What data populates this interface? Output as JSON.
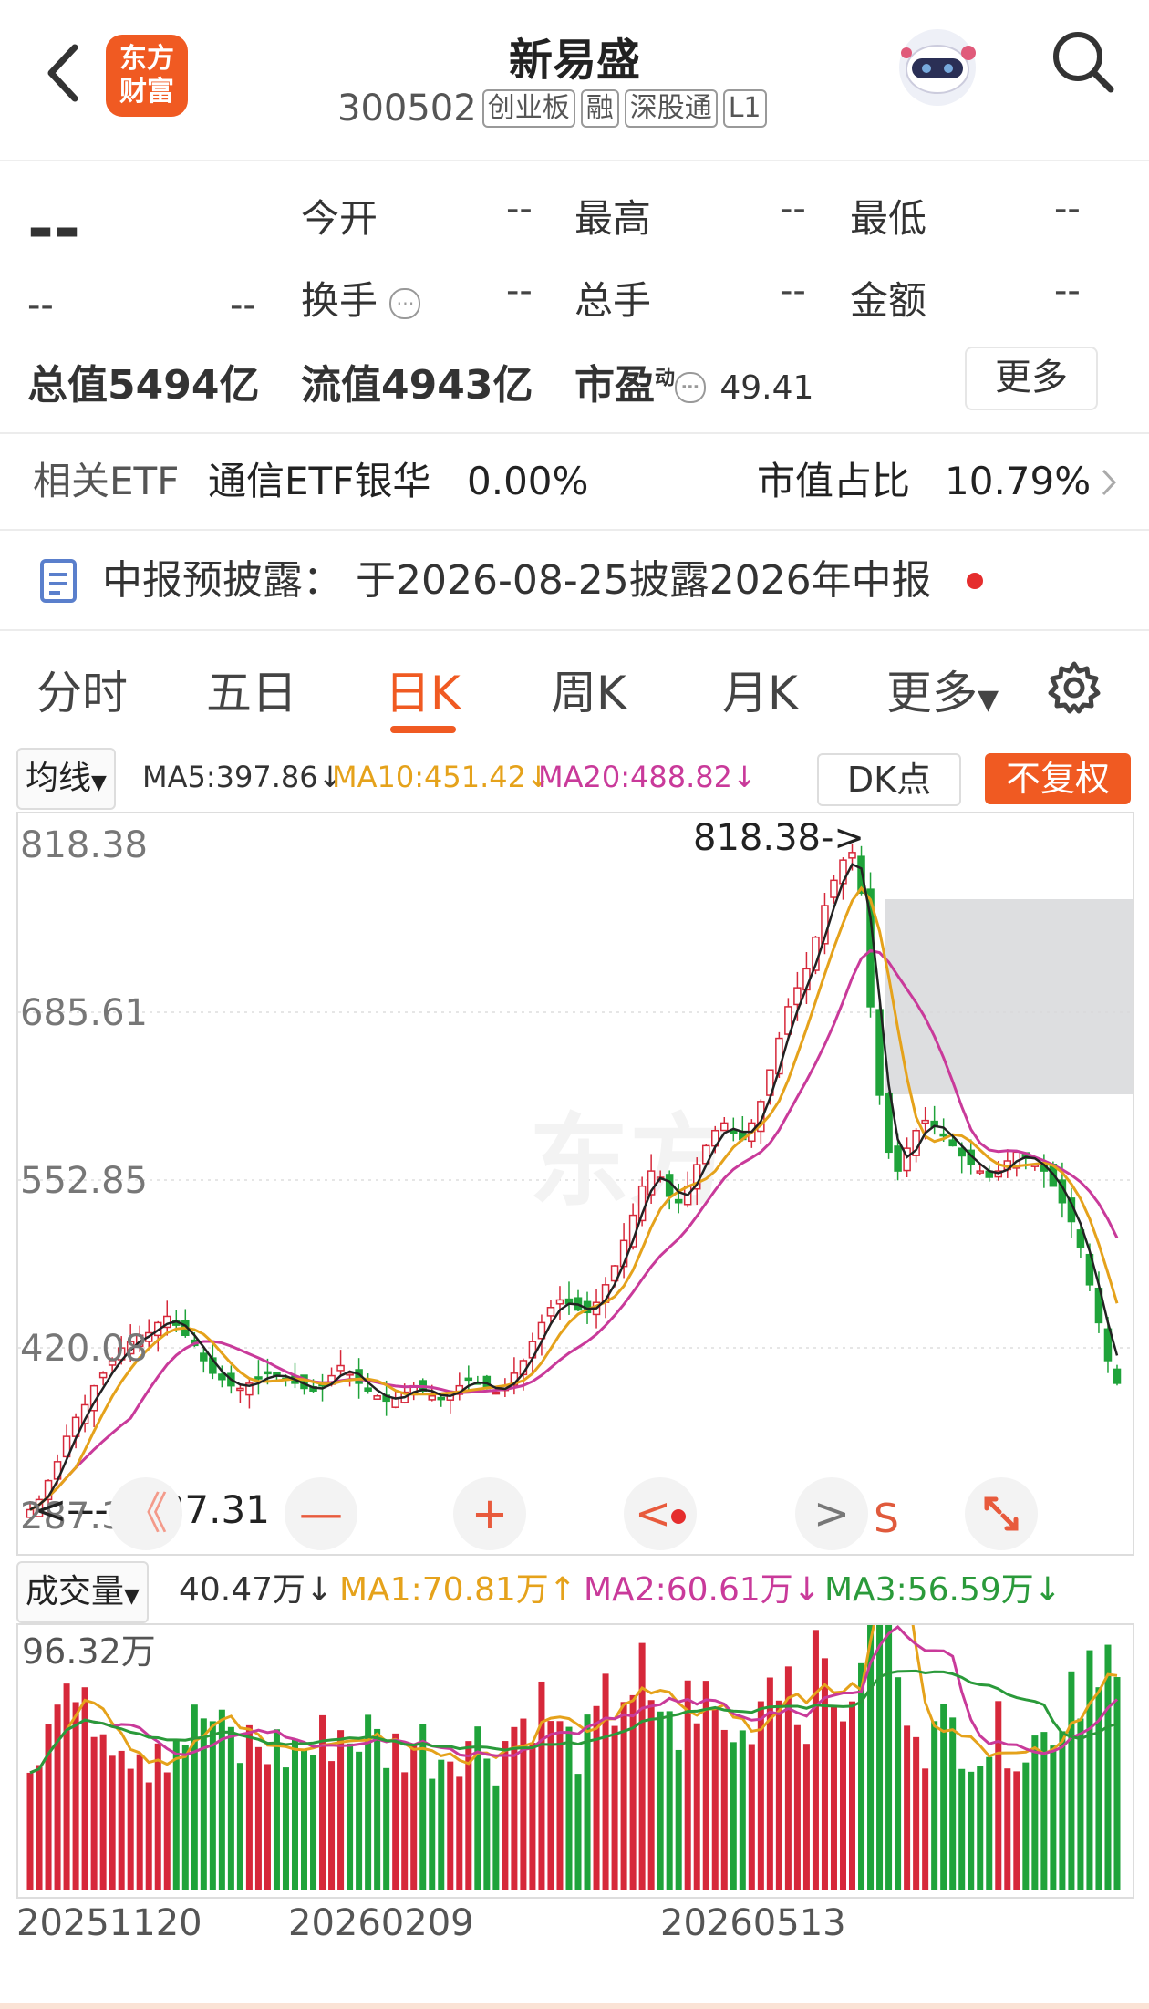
{
  "header": {
    "title": "新易盛",
    "code": "300502",
    "tags": [
      "创业板",
      "融",
      "深股通",
      "L1"
    ],
    "logo_line1": "东方",
    "logo_line2": "财富"
  },
  "quote": {
    "price": "--",
    "change": "--",
    "change_pct": "--",
    "open_label": "今开",
    "open": "--",
    "high_label": "最高",
    "high": "--",
    "low_label": "最低",
    "low": "--",
    "turnover_label": "换手",
    "turnover": "--",
    "volume_label": "总手",
    "volume": "--",
    "amount_label": "金额",
    "amount": "--",
    "total_cap": "总值5494亿",
    "float_cap": "流值4943亿",
    "pe_label": "市盈",
    "pe_sup": "动",
    "pe": "49.41",
    "more": "更多"
  },
  "etf": {
    "label": "相关ETF",
    "name": "通信ETF银华",
    "pct": "0.00%",
    "ratio_label": "市值占比",
    "ratio": "10.79%"
  },
  "disclosure": {
    "text": "中报预披露：  于2026-08-25披露2026年中报"
  },
  "tabs": [
    "分时",
    "五日",
    "日K",
    "周K",
    "月K",
    "更多"
  ],
  "active_tab": 2,
  "ma_bar": {
    "selector": "均线",
    "ma5": "MA5:397.86",
    "ma10": "MA10:451.42",
    "ma20": "MA20:488.82",
    "dk": "DK点",
    "fuquan": "不复权"
  },
  "vol_bar": {
    "selector": "成交量",
    "vol": "40.47万",
    "ma1": "MA1:70.81万",
    "ma2": "MA2:60.61万",
    "ma3": "MA3:56.59万"
  },
  "chart_data": {
    "type": "candlestick",
    "y_ticks": [
      "818.38",
      "685.61",
      "552.85",
      "420.08",
      "287.31"
    ],
    "ylim": [
      287.31,
      818.38
    ],
    "high_annotation": "818.38->",
    "low_annotation": "<-----287.31",
    "vol_max_label": "96.32万",
    "date_ticks": [
      "20251120",
      "20260209",
      "20260513"
    ],
    "close_series": [
      292,
      300,
      315,
      330,
      350,
      365,
      375,
      390,
      400,
      410,
      420,
      425,
      430,
      432,
      440,
      445,
      438,
      430,
      422,
      410,
      400,
      395,
      390,
      388,
      392,
      396,
      400,
      398,
      395,
      392,
      388,
      386,
      390,
      398,
      406,
      400,
      392,
      386,
      382,
      378,
      380,
      385,
      390,
      386,
      382,
      380,
      384,
      390,
      396,
      392,
      388,
      385,
      390,
      400,
      410,
      425,
      440,
      452,
      458,
      455,
      450,
      448,
      456,
      470,
      485,
      505,
      525,
      548,
      560,
      555,
      540,
      535,
      548,
      565,
      580,
      592,
      598,
      590,
      585,
      598,
      615,
      640,
      665,
      690,
      705,
      720,
      745,
      770,
      790,
      806,
      812,
      780,
      690,
      620,
      575,
      560,
      578,
      592,
      600,
      595,
      588,
      580,
      572,
      565,
      560,
      555,
      560,
      568,
      575,
      570,
      565,
      560,
      548,
      535,
      520,
      500,
      470,
      440,
      410,
      392
    ]
  },
  "controls": [
    "《",
    "—",
    "+",
    "<",
    ">",
    "S",
    "expand"
  ]
}
